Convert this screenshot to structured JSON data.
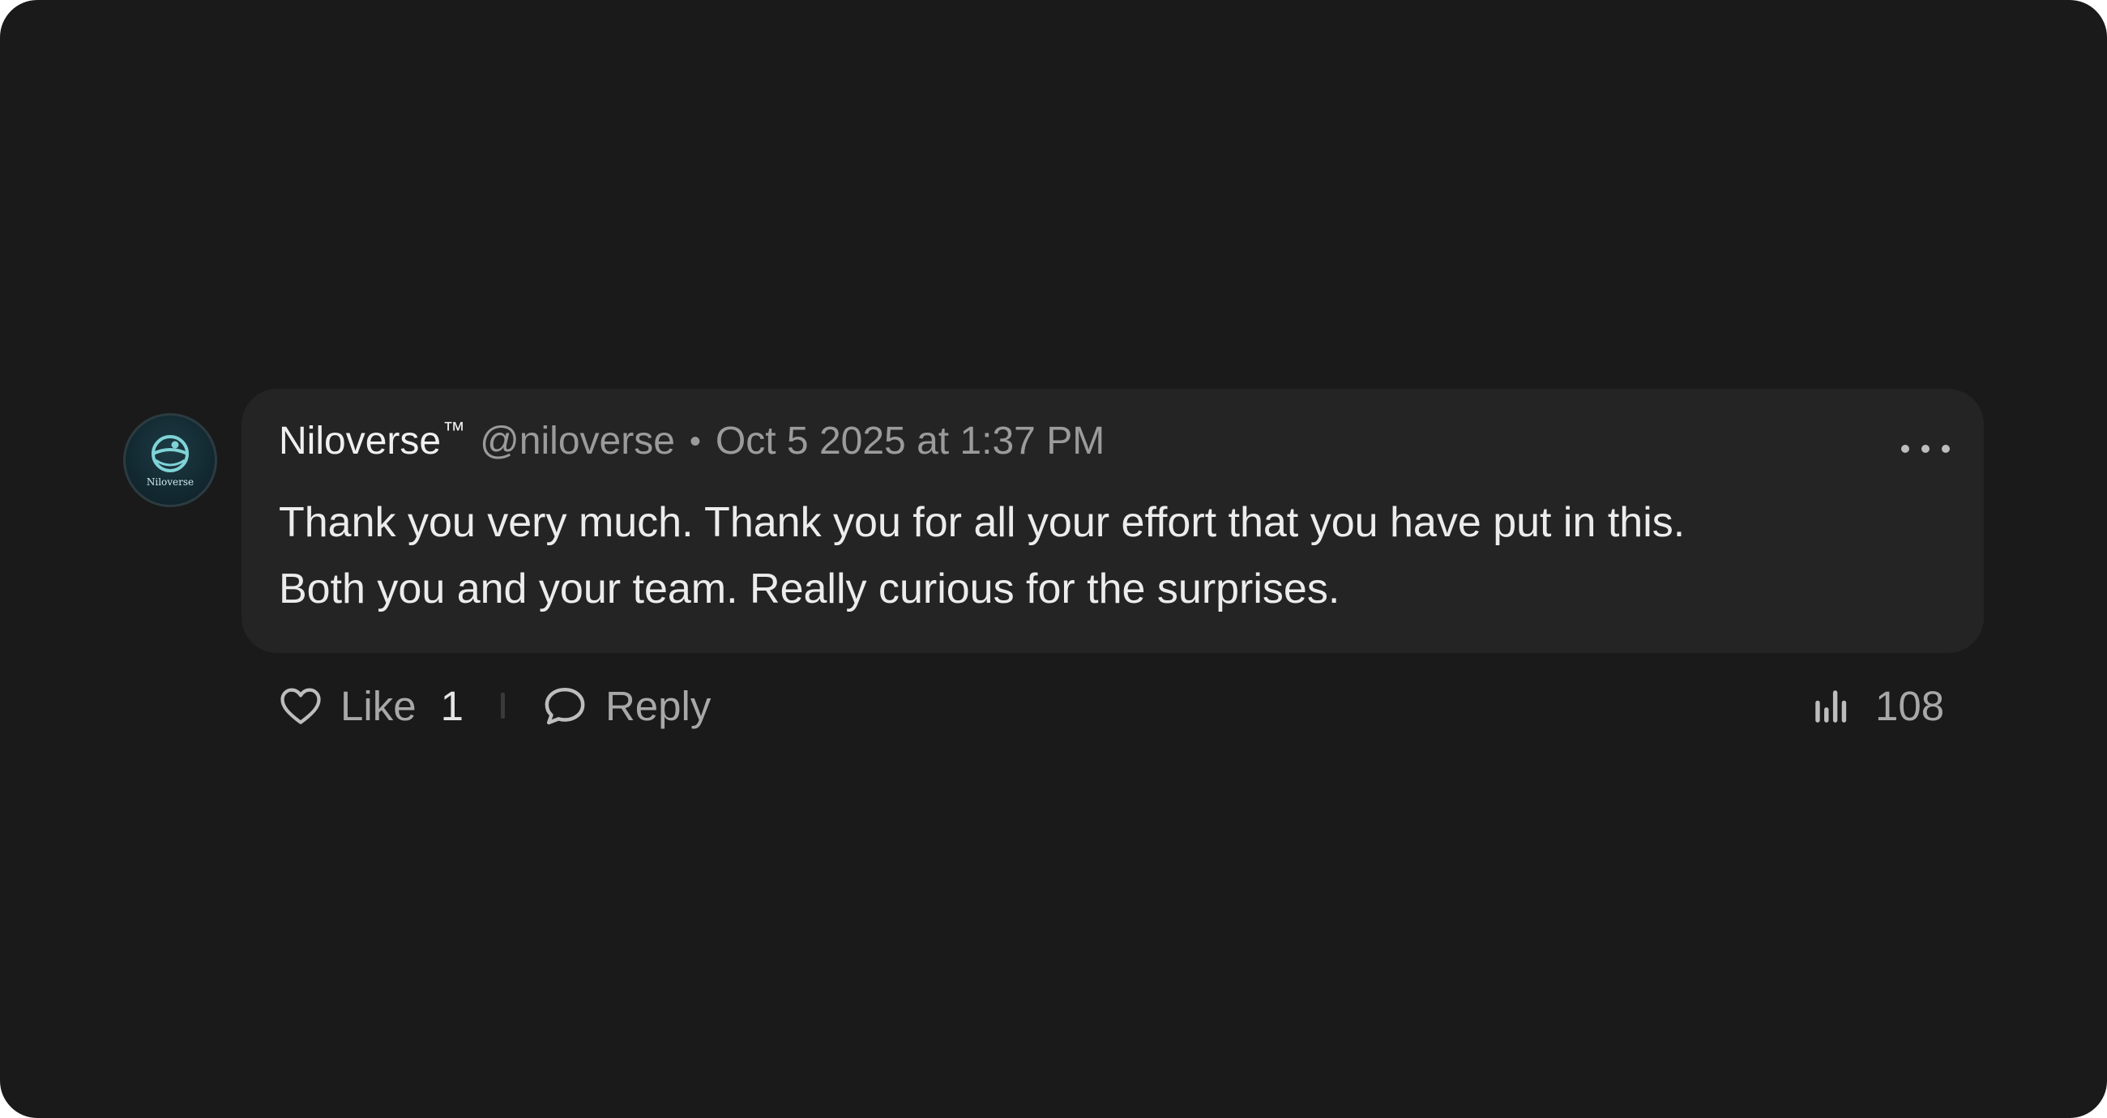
{
  "comment": {
    "author_name": "Niloverse",
    "author_mark": "™",
    "author_handle": "@niloverse",
    "separator": "•",
    "timestamp": "Oct 5 2025 at 1:37 PM",
    "avatar_text": "Niloverse",
    "body_lines": [
      "Thank you very much. Thank you for all your effort that you have put in this.",
      "Both you and your team. Really curious for the surprises."
    ]
  },
  "actions": {
    "like_label": "Like",
    "like_count": "1",
    "reply_label": "Reply",
    "views_count": "108"
  },
  "icons": {
    "more": "more-horizontal-icon",
    "like": "heart-icon",
    "reply": "speech-bubble-icon",
    "views": "bar-chart-icon"
  },
  "colors": {
    "background": "#1a1a1a",
    "bubble": "#242424",
    "avatar_accent": "#7fd3d6",
    "name_text": "#f0f0f0",
    "muted_text": "#9b9b9b"
  }
}
